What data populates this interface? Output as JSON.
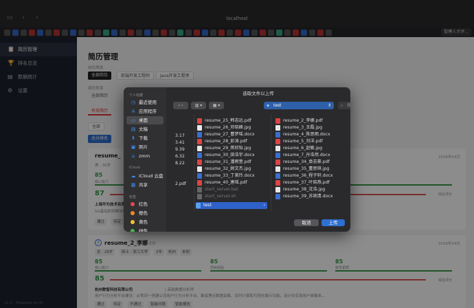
{
  "browser": {
    "url": "localhost",
    "last_tab": "智聘人才评..."
  },
  "sidebar": {
    "items": [
      {
        "icon": "📋",
        "icon_name": "resume-icon",
        "label": "简历管理"
      },
      {
        "icon": "🏆",
        "icon_name": "trophy-icon",
        "label": "排名总览"
      },
      {
        "icon": "▤",
        "icon_name": "chart-icon",
        "label": "数据统计"
      },
      {
        "icon": "⚙",
        "icon_name": "gear-icon",
        "label": "设置"
      }
    ],
    "footer": "v1.0 · Powered by AI"
  },
  "main": {
    "title": "简历管理",
    "position_filter_label": "岗位筛选",
    "position_chips": [
      "全部岗位",
      "前端开发工程师",
      "Java开发工程师"
    ],
    "source_filter_label": "简历来源",
    "source_chips": [
      "全部简历"
    ],
    "tab_label": "有效简历",
    "filter_all": "全部",
    "rank_btn": "总分排名",
    "date1": "2026年04月",
    "date2": "2026年04月",
    "card1": {
      "name": "resume_",
      "meta": "男 · 30岁",
      "score1": "85",
      "score1_label": "核心能力",
      "total": "87",
      "total_label": "综合评分",
      "company": "上海华为技术有限",
      "desc": "5G基站射频模块研",
      "actions": [
        "通过",
        "待定"
      ]
    },
    "card2": {
      "rank": "2",
      "name": "resume_2_李娜",
      "type": "文件",
      "meta": [
        "女 · 28岁",
        "硕士 · 浙江大学",
        "2年",
        "杭州",
        "未知"
      ],
      "scores": [
        {
          "value": "85",
          "label": "核心能力"
        },
        {
          "value": "85",
          "label": "项目经验"
        },
        {
          "value": "85",
          "label": "软性素质"
        }
      ],
      "total": "85",
      "total_label": "综合评分",
      "company": "杭州数智科技有限公司",
      "company_role": "| 高级数据分析师",
      "desc": "用户行为分析平台建设：从零到一搭建公司用户行为分析平台，集成埋点数据采集、实时计算和可视化展示功能，设计并实现用户画像体...",
      "actions": [
        "通过",
        "待定",
        "不通过",
        "智能问题",
        "智能报告"
      ]
    }
  },
  "dialog": {
    "title": "选取文件以上传",
    "sidebar": {
      "personal_section": "个人收藏",
      "personal": [
        {
          "icon": "◷",
          "icon_name": "recents-icon",
          "label": "最近使用"
        },
        {
          "icon": "A",
          "icon_name": "applications-icon",
          "label": "应用程序"
        },
        {
          "icon": "▭",
          "icon_name": "desktop-icon",
          "label": "桌面"
        },
        {
          "icon": "▤",
          "icon_name": "documents-icon",
          "label": "文稿"
        },
        {
          "icon": "⬇",
          "icon_name": "downloads-icon",
          "label": "下载"
        },
        {
          "icon": "▣",
          "icon_name": "pictures-icon",
          "label": "照片"
        },
        {
          "icon": "⌂",
          "icon_name": "home-icon",
          "label": "zmm"
        }
      ],
      "icloud_section": "iCloud",
      "icloud": [
        {
          "icon": "☁",
          "icon_name": "icloud-icon",
          "label": "iCloud 云盘"
        },
        {
          "icon": "▦",
          "icon_name": "shared-icon",
          "label": "共享"
        }
      ],
      "tags_section": "标签",
      "tags": [
        {
          "label": "红色",
          "color": "#e5484d"
        },
        {
          "label": "橙色",
          "color": "#f08a24"
        },
        {
          "label": "黄色",
          "color": "#f2c230"
        },
        {
          "label": "绿色",
          "color": "#3fb950"
        }
      ]
    },
    "location": "test",
    "search_placeholder": "搜索",
    "col1_fragments": [
      "3.17",
      "3.41",
      "9.39",
      "6.32",
      "8.22",
      "2.pdf"
    ],
    "col2_files": [
      {
        "name": "resume_25_韩志远.pdf",
        "type": "pdf"
      },
      {
        "name": "resume_26_邓晓峰.jpg",
        "type": "jpg"
      },
      {
        "name": "resume_27_曹梦瑶.docx",
        "type": "doc"
      },
      {
        "name": "resume_28_彭涛.pdf",
        "type": "pdf"
      },
      {
        "name": "resume_29_蒋欣怡.jpg",
        "type": "jpg"
      },
      {
        "name": "resume_30_田浩宇.docx",
        "type": "doc"
      },
      {
        "name": "resume_31_潘雨萱.pdf",
        "type": "pdf"
      },
      {
        "name": "resume_32_顾文杰.jpg",
        "type": "jpg"
      },
      {
        "name": "resume_33_丁美玲.docx",
        "type": "doc"
      },
      {
        "name": "resume_40_唐瑶.pdf",
        "type": "pdf"
      },
      {
        "name": "start_server.bat",
        "type": "dis"
      },
      {
        "name": "start_server.sh",
        "type": "dis"
      },
      {
        "name": "test",
        "type": "fold"
      }
    ],
    "col3_files": [
      {
        "name": "resume_2_李娜.pdf",
        "type": "pdf"
      },
      {
        "name": "resume_3_王磊.jpg",
        "type": "jpg"
      },
      {
        "name": "resume_4_陈思雨.docx",
        "type": "doc"
      },
      {
        "name": "resume_5_刘洋.pdf",
        "type": "pdf"
      },
      {
        "name": "resume_6_赵敏.jpg",
        "type": "jpg"
      },
      {
        "name": "resume_7_孙浩然.docx",
        "type": "doc"
      },
      {
        "name": "resume_34_袁志豪.pdf",
        "type": "pdf"
      },
      {
        "name": "resume_35_董思琪.jpg",
        "type": "jpg"
      },
      {
        "name": "resume_36_程子轩.docx",
        "type": "doc"
      },
      {
        "name": "resume_37_叶晓燕.pdf",
        "type": "pdf"
      },
      {
        "name": "resume_38_沈浩.jpg",
        "type": "jpg"
      },
      {
        "name": "resume_39_苏婉清.docx",
        "type": "doc"
      }
    ],
    "cancel_label": "取消",
    "upload_label": "上传"
  }
}
